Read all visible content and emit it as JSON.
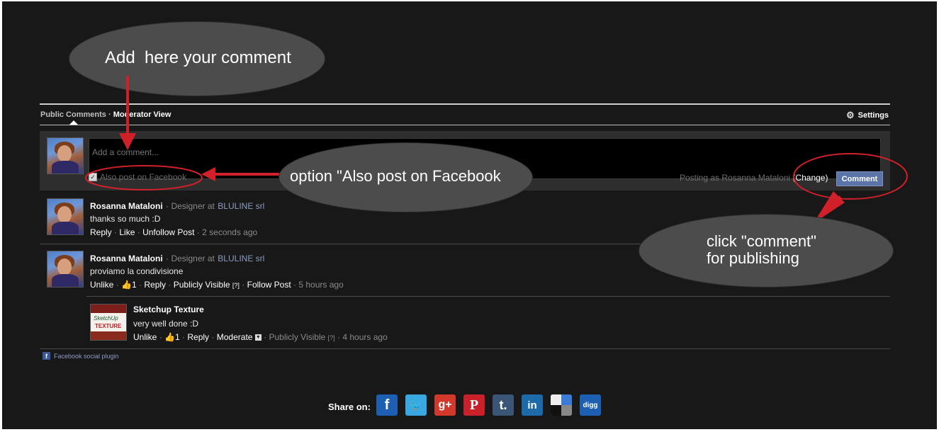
{
  "annotations": {
    "add_comment": "Add  here your comment",
    "also_post": "option \"Also post on Facebook",
    "click_comment_line1": "click \"comment\"",
    "click_comment_line2": "for publishing"
  },
  "tabs": {
    "public_comments": "Public Comments",
    "separator": "·",
    "moderator_view": "Moderator View",
    "settings": "Settings"
  },
  "composer": {
    "placeholder": "Add a comment...",
    "also_post_label": "Also post on Facebook",
    "also_post_checked": true,
    "posting_as": "Posting as Rosanna Mataloni",
    "change_label": "(Change)",
    "comment_button": "Comment"
  },
  "comments": [
    {
      "author": "Rosanna Mataloni",
      "role_prefix": "· Designer at",
      "company": "BLULINE srl",
      "text": "thanks so much :D",
      "actions": {
        "reply": "Reply",
        "like": "Like",
        "unfollow": "Unfollow Post",
        "time": "2 seconds ago"
      }
    },
    {
      "author": "Rosanna Mataloni",
      "role_prefix": "· Designer at",
      "company": "BLULINE srl",
      "text": "proviamo la condivisione",
      "actions": {
        "unlike": "Unlike",
        "like_count": "1",
        "reply": "Reply",
        "visibility": "Publicly Visible",
        "help": "[?]",
        "follow": "Follow Post",
        "time": "5 hours ago"
      },
      "replies": [
        {
          "author": "Sketchup Texture",
          "text": "very well done :D",
          "thumb_lines": [
            "SketchUp",
            "TEXTURE"
          ],
          "actions": {
            "unlike": "Unlike",
            "like_count": "1",
            "reply": "Reply",
            "moderate": "Moderate",
            "visibility": "Publicly Visible",
            "help": "[?]",
            "time": "4 hours ago"
          }
        }
      ]
    }
  ],
  "plugin_label": "Facebook social plugin",
  "share": {
    "label": "Share on:",
    "icons": [
      {
        "name": "facebook-icon",
        "glyph": "f",
        "color": "#1d5fb3"
      },
      {
        "name": "twitter-icon",
        "glyph": "🐦",
        "color": "#3aa7e0"
      },
      {
        "name": "google-plus-icon",
        "glyph": "g+",
        "color": "#d2382b"
      },
      {
        "name": "pinterest-icon",
        "glyph": "P",
        "color": "#c9202a"
      },
      {
        "name": "tumblr-icon",
        "glyph": "t.",
        "color": "#3b5577"
      },
      {
        "name": "linkedin-icon",
        "glyph": "in",
        "color": "#1d6aa8"
      },
      {
        "name": "delicious-icon",
        "glyph": "",
        "color": "#cccccc"
      },
      {
        "name": "digg-icon",
        "glyph": "digg",
        "color": "#1d5fb3"
      }
    ]
  },
  "colors": {
    "background": "#181818",
    "annotation_bubble": "#4c4c4c",
    "annotation_arrow": "#d0202a",
    "comment_button": "#5b74a8",
    "link": "#8b9dc3"
  }
}
